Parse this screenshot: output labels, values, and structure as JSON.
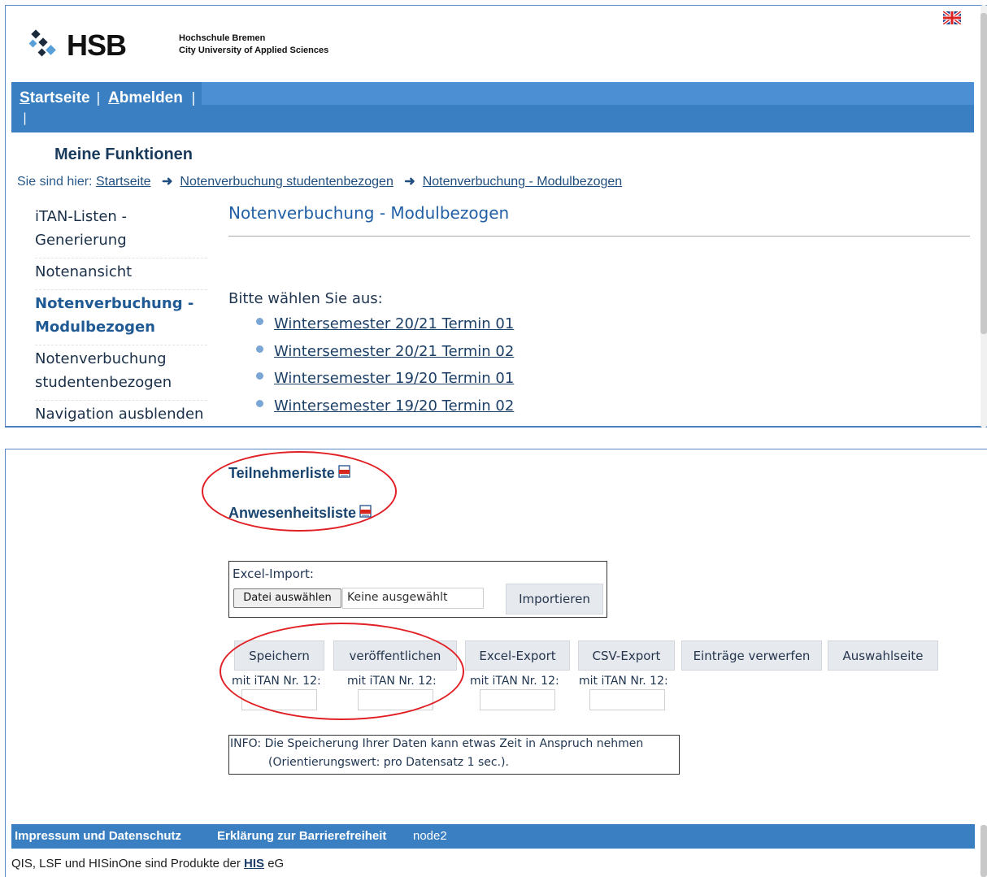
{
  "header": {
    "logo": "HSB",
    "university_line1": "Hochschule Bremen",
    "university_line2": "City University of Applied Sciences",
    "language_icon": "uk-flag-icon"
  },
  "navbar": {
    "home": {
      "accesskey": "S",
      "rest": "tartseite"
    },
    "logout": {
      "accesskey": "A",
      "rest": "bmelden"
    },
    "separator": "|"
  },
  "section_title": "Meine Funktionen",
  "breadcrumb": {
    "prefix": "Sie sind hier:",
    "items": [
      "Startseite",
      "Notenverbuchung studentenbezogen",
      "Notenverbuchung - Modulbezogen"
    ]
  },
  "sidebar": {
    "items": [
      {
        "label": "iTAN-Listen - Generierung",
        "active": false
      },
      {
        "label": "Notenansicht",
        "active": false
      },
      {
        "label": "Notenverbuchung - Modulbezogen",
        "active": true
      },
      {
        "label": "Notenverbuchung studentenbezogen",
        "active": false
      },
      {
        "label": "Navigation ausblenden",
        "active": false
      }
    ]
  },
  "main": {
    "title": "Notenverbuchung - Modulbezogen",
    "prompt": "Bitte wählen Sie aus:",
    "semesters": [
      "Wintersemester 20/21 Termin 01",
      "Wintersemester 20/21 Termin 02",
      "Wintersemester 19/20 Termin 01",
      "Wintersemester 19/20 Termin 02"
    ]
  },
  "documents": {
    "participants": "Teilnehmerliste",
    "attendance": "Anwesenheitsliste",
    "icon": "pdf-icon"
  },
  "excel_import": {
    "label": "Excel-Import:",
    "choose_file": "Datei auswählen",
    "no_file": "Keine ausgewählt",
    "import_button": "Importieren"
  },
  "actions": {
    "buttons": [
      "Speichern",
      "veröffentlichen",
      "Excel-Export",
      "CSV-Export",
      "Einträge verwerfen",
      "Auswahlseite"
    ],
    "itan_label": "mit iTAN Nr. 12:"
  },
  "info": {
    "line1": "INFO: Die Speicherung Ihrer Daten kann etwas Zeit in Anspruch nehmen",
    "line2": "(Orientierungswert: pro Datensatz 1 sec.)."
  },
  "footer": {
    "imprint": "Impressum und Datenschutz",
    "accessibility": "Erklärung zur Barrierefreiheit",
    "node": "node2",
    "credit_prefix": "QIS, LSF und HISinOne sind Produkte der",
    "credit_link": "HIS",
    "credit_suffix": "eG"
  },
  "colors": {
    "navbar": "#3a7fc1",
    "annotation": "#e12025",
    "link": "#1c3f66"
  }
}
